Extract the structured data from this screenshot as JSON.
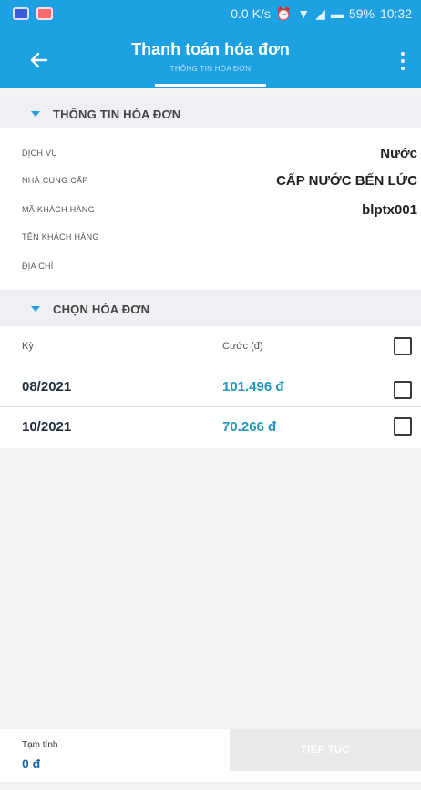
{
  "status_bar": {
    "speed": "0.0 K/s",
    "battery": "59%",
    "time": "10:32"
  },
  "header": {
    "title": "Thanh toán hóa đơn",
    "subtitle": "THÔNG TIN HÓA ĐƠN",
    "accent_color": "#1da1e2"
  },
  "invoice_info": {
    "section_title": "THÔNG TIN HÓA ĐƠN",
    "rows": [
      {
        "label": "DỊCH VỤ",
        "value": "Nước"
      },
      {
        "label": "NHÀ CUNG CẤP",
        "value": "CẤP NƯỚC BẾN LỨC"
      },
      {
        "label": "MÃ KHÁCH HÀNG",
        "value": "blptx001"
      },
      {
        "label": "TÊN KHÁCH HÀNG",
        "value": ""
      },
      {
        "label": "ĐỊA CHỈ",
        "value": ""
      }
    ]
  },
  "bill_select": {
    "section_title": "CHỌN HÓA ĐƠN",
    "col_period": "Kỳ",
    "col_fee": "Cước (đ)",
    "rows": [
      {
        "period": "08/2021",
        "amount": "101.496 đ",
        "checked": false
      },
      {
        "period": "10/2021",
        "amount": "70.266 đ",
        "checked": false
      }
    ]
  },
  "footer": {
    "subtotal_label": "Tạm tính",
    "subtotal_value": "0 đ",
    "continue_label": "TIẾP TỤC"
  }
}
